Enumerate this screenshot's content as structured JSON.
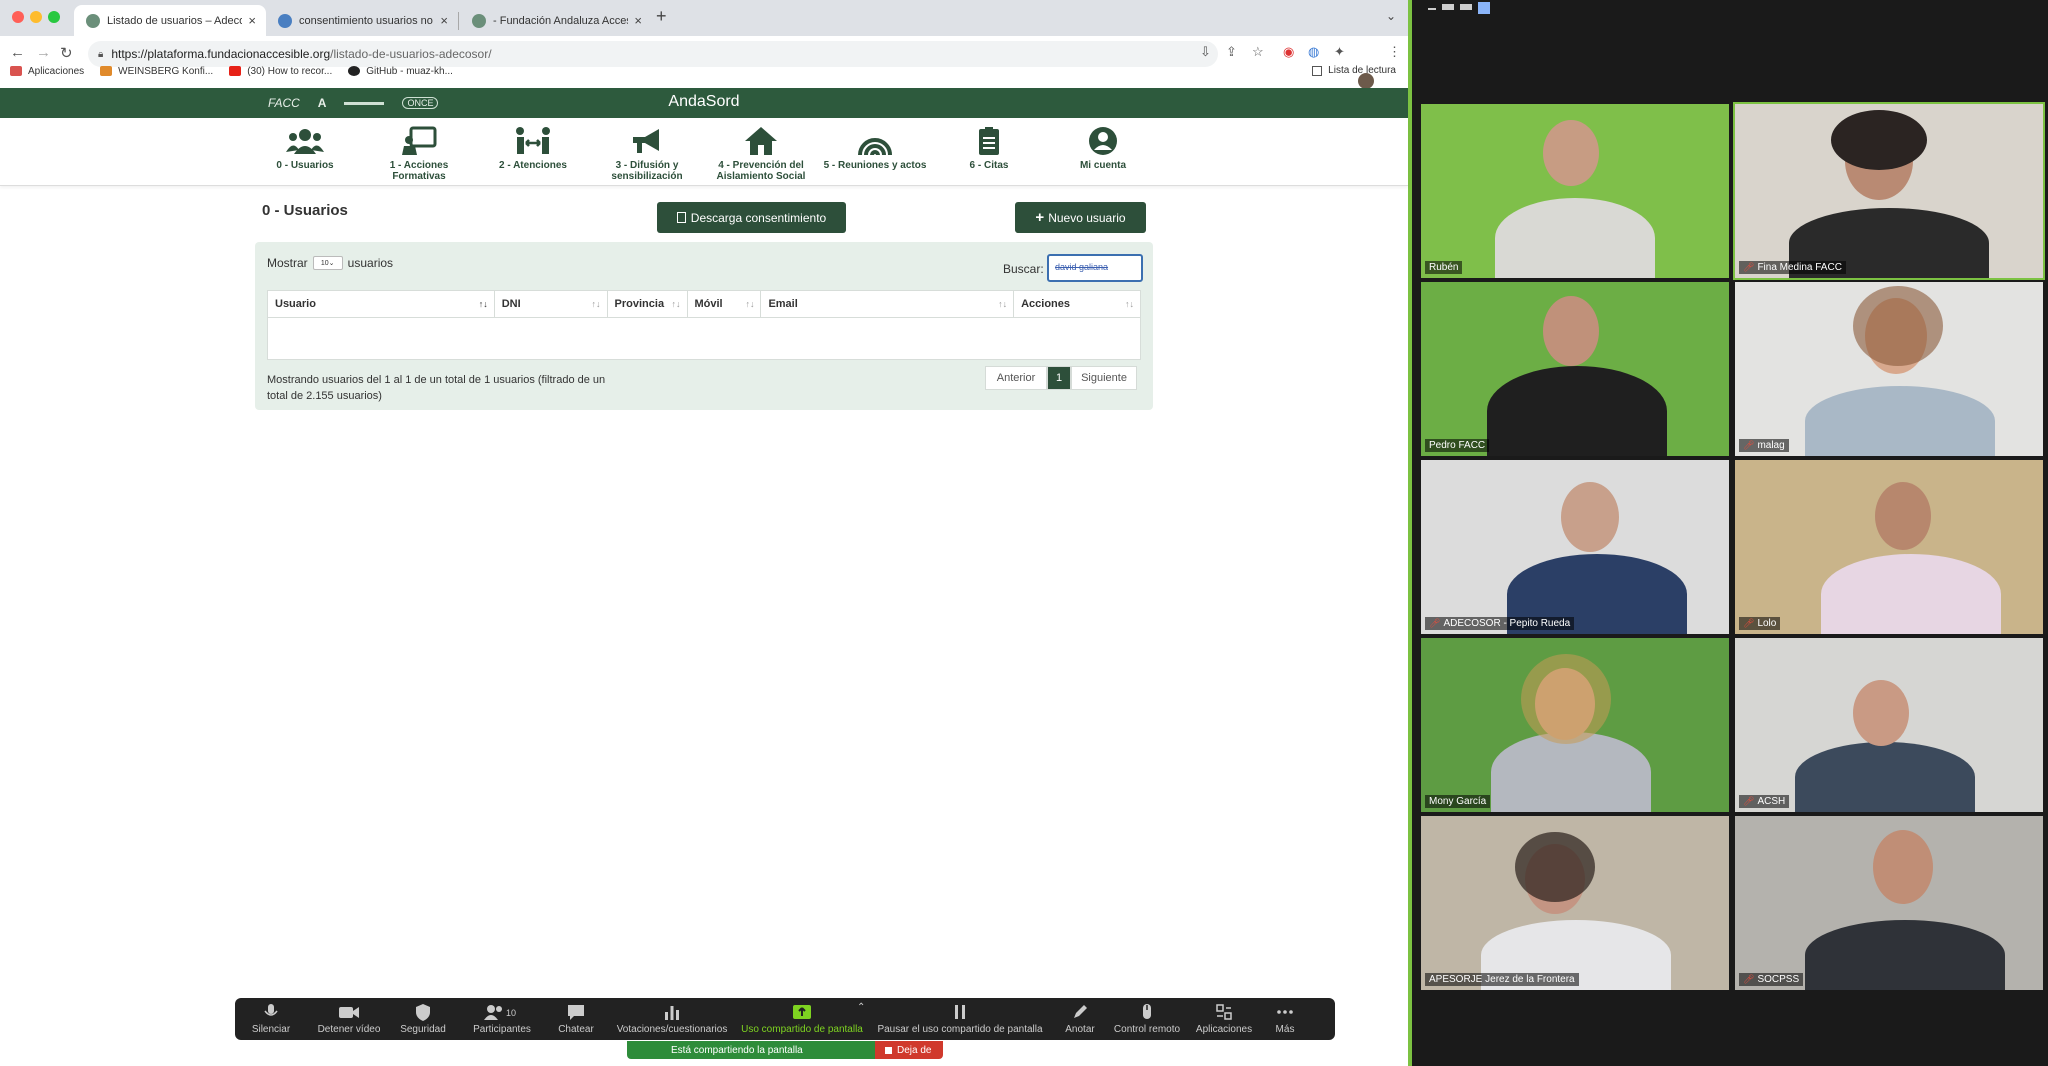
{
  "browser": {
    "tabs": [
      {
        "title": "Listado de usuarios – Adecosor",
        "active": true
      },
      {
        "title": "consentimiento usuarios no reg",
        "active": false
      },
      {
        "title": "- Fundación Andaluza Accesib",
        "active": false
      }
    ],
    "url_host": "https://plataforma.fundacionaccesible.org",
    "url_path": "/listado-de-usuarios-adecosor/",
    "bookmarks": [
      {
        "label": "Aplicaciones",
        "color": "#d9534f"
      },
      {
        "label": "WEINSBERG Konfi...",
        "color": "#e08a2b"
      },
      {
        "label": "(30) How to recor...",
        "color": "#e62117"
      },
      {
        "label": "GitHub - muaz-kh...",
        "color": "#222222"
      }
    ],
    "reading_list": "Lista de lectura"
  },
  "site": {
    "logos": [
      "FACC",
      "A",
      "ONCE"
    ],
    "title": "AndaSord",
    "nav": [
      {
        "label": "0 - Usuarios",
        "icon": "users-icon"
      },
      {
        "label": "1 - Acciones Formativas",
        "icon": "teacher-board-icon"
      },
      {
        "label": "2 - Atenciones",
        "icon": "people-arrows-icon"
      },
      {
        "label": "3 - Difusión y sensibilización",
        "icon": "megaphone-icon"
      },
      {
        "label": "4 - Prevención del Aislamiento Social",
        "icon": "house-icon"
      },
      {
        "label": "5 - Reuniones y actos",
        "icon": "arches-icon"
      },
      {
        "label": "6 - Citas",
        "icon": "clipboard-icon"
      },
      {
        "label": "Mi cuenta",
        "icon": "user-circle-icon"
      }
    ],
    "page_title": "0 - Usuarios",
    "download_button": "Descarga consentimiento",
    "new_user_button": "Nuevo usuario",
    "show_label": "Mostrar",
    "show_value": "10",
    "show_suffix": "usuarios",
    "search_label": "Buscar:",
    "search_value": "david galiana",
    "columns": [
      "Usuario",
      "DNI",
      "Provincia",
      "Móvil",
      "Email",
      "Acciones"
    ],
    "info": "Mostrando usuarios del 1 al 1 de un total de 1 usuarios (filtrado de un total de 2.155 usuarios)",
    "pager": {
      "prev": "Anterior",
      "current": "1",
      "next": "Siguiente"
    },
    "brand_color": "#2d4f3a"
  },
  "zoom_toolbar": [
    {
      "label": "Silenciar",
      "icon": "microphone-icon"
    },
    {
      "label": "Detener vídeo",
      "icon": "video-camera-icon"
    },
    {
      "label": "Seguridad",
      "icon": "shield-icon"
    },
    {
      "label": "Participantes",
      "icon": "participants-icon",
      "count": "10"
    },
    {
      "label": "Chatear",
      "icon": "chat-bubble-icon"
    },
    {
      "label": "Votaciones/cuestionarios",
      "icon": "bar-chart-icon"
    },
    {
      "label": "Uso compartido de pantalla",
      "icon": "share-screen-icon"
    },
    {
      "label": "Pausar el uso compartido de pantalla",
      "icon": "pause-icon"
    },
    {
      "label": "Anotar",
      "icon": "pencil-icon"
    },
    {
      "label": "Control remoto",
      "icon": "mouse-icon"
    },
    {
      "label": "Aplicaciones",
      "icon": "apps-icon"
    },
    {
      "label": "Más",
      "icon": "more-dots-icon"
    }
  ],
  "sharing": {
    "message": "Está compartiendo la pantalla",
    "stop": "Deja de"
  },
  "participants": [
    {
      "name": "Rubén",
      "muted": false,
      "bg": "#7fbf4a"
    },
    {
      "name": "Fina Medina FACC",
      "muted": true,
      "bg": "#d9d4cc"
    },
    {
      "name": "Pedro FACC",
      "muted": false,
      "bg": "#6cae45"
    },
    {
      "name": "malag",
      "muted": true,
      "bg": "#e3e3e1"
    },
    {
      "name": "ADECOSOR - Pepito Rueda",
      "muted": true,
      "bg": "#dcdcdc"
    },
    {
      "name": "Lolo",
      "muted": true,
      "bg": "#c9b48a"
    },
    {
      "name": "Mony García",
      "muted": false,
      "bg": "#5e9c43"
    },
    {
      "name": "ACSH",
      "muted": true,
      "bg": "#d6d6d3"
    },
    {
      "name": "APESORJE Jerez de la Frontera",
      "muted": false,
      "bg": "#bfb6a6"
    },
    {
      "name": "SOCPSS",
      "muted": true,
      "bg": "#b4b2ad"
    }
  ]
}
